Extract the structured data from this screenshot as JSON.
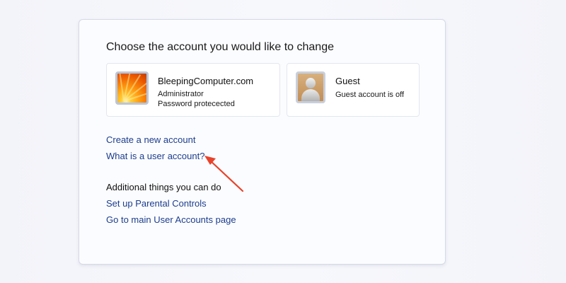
{
  "panel": {
    "heading": "Choose the account you would like to change"
  },
  "accounts": [
    {
      "name": "BleepingComputer.com",
      "lines": [
        "Administrator",
        "Password protecected"
      ],
      "avatar_icon": "sunflower-picture-icon"
    },
    {
      "name": "Guest",
      "lines": [
        "Guest account is off"
      ],
      "avatar_icon": "guest-person-icon"
    }
  ],
  "links": {
    "create_account": "Create a new account",
    "what_is_account": "What is a user account?"
  },
  "additional": {
    "heading": "Additional things you can do",
    "parental_controls": "Set up Parental Controls",
    "main_page": "Go to main User Accounts page"
  },
  "annotation": {
    "icon": "red-arrow-icon",
    "color": "#e8432b"
  }
}
